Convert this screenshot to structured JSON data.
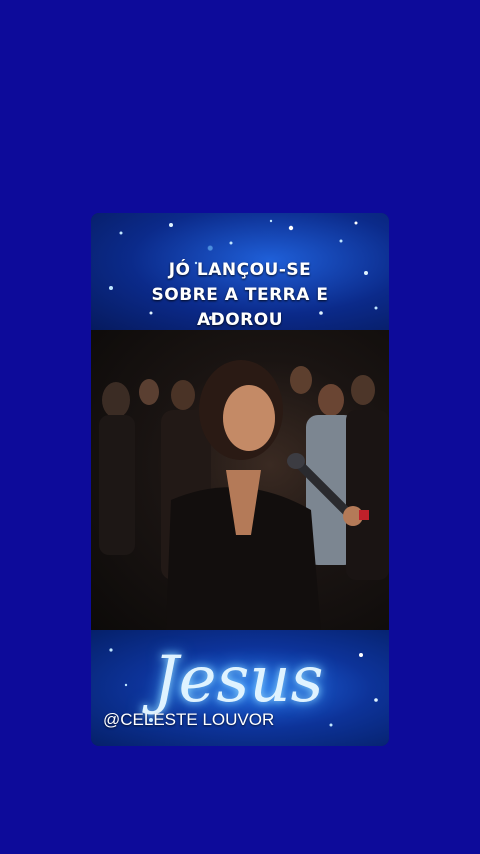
{
  "caption": {
    "line1": "JÓ LANÇOU-SE",
    "line2": "SOBRE A TERRA E",
    "line3": "ADOROU"
  },
  "overlay": {
    "script_text": "Jesus",
    "handle": "@CELESTE LOUVOR"
  },
  "colors": {
    "page_background": "#0d0b9a",
    "banner_blue": "#1f5fd8",
    "glow": "#8fd8ff"
  }
}
